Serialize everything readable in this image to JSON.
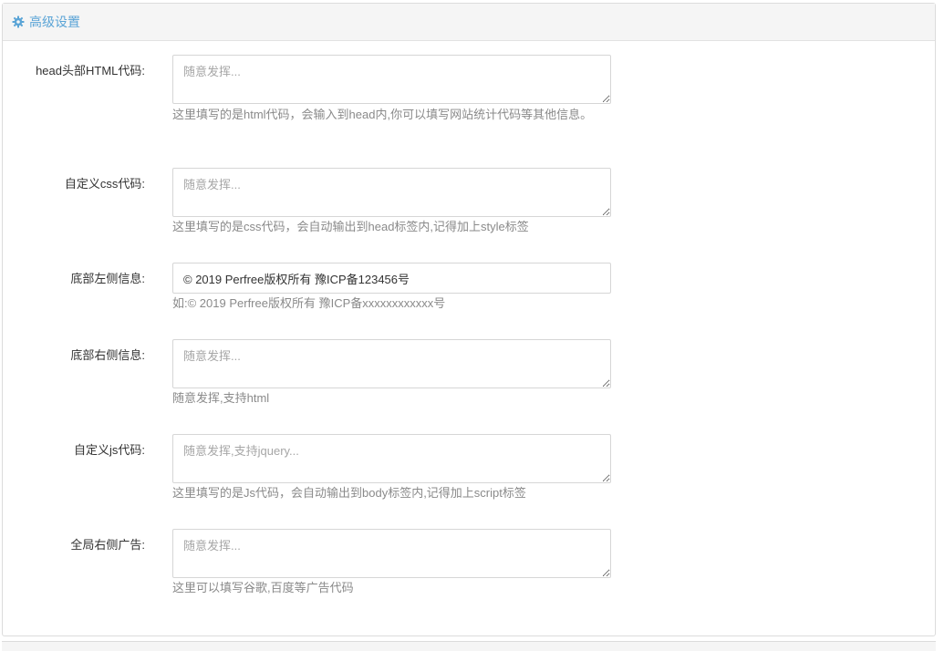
{
  "panel": {
    "title": "高级设置",
    "icon": "gear-icon",
    "accent_color": "#5aa4d6"
  },
  "fields": [
    {
      "label": "head头部HTML代码:",
      "value": "",
      "placeholder": "随意发挥...",
      "help": "这里填写的是html代码，会输入到head内,你可以填写网站统计代码等其他信息。"
    },
    {
      "label": "自定义css代码:",
      "value": "",
      "placeholder": "随意发挥...",
      "help": "这里填写的是css代码，会自动输出到head标签内,记得加上style标签"
    },
    {
      "label": "底部左侧信息:",
      "value": "© 2019 Perfree版权所有 豫ICP备123456号",
      "placeholder": "",
      "help": "如:© 2019 Perfree版权所有 豫ICP备xxxxxxxxxxxx号"
    },
    {
      "label": "底部右侧信息:",
      "value": "",
      "placeholder": "随意发挥...",
      "help": "随意发挥,支持html"
    },
    {
      "label": "自定义js代码:",
      "value": "",
      "placeholder": "随意发挥,支持jquery...",
      "help": "这里填写的是Js代码，会自动输出到body标签内,记得加上script标签"
    },
    {
      "label": "全局右侧广告:",
      "value": "",
      "placeholder": "随意发挥...",
      "help": "这里可以填写谷歌,百度等广告代码"
    }
  ]
}
